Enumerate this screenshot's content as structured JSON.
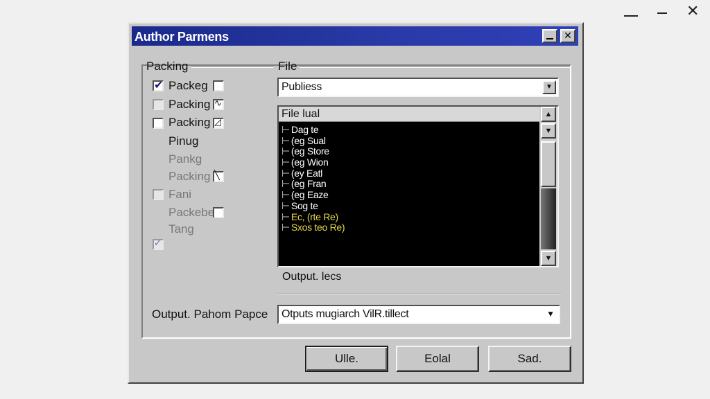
{
  "dialog": {
    "title": "Author Parmens"
  },
  "packing": {
    "group_label": "Packing",
    "rows": [
      {
        "label": "Packeg"
      },
      {
        "label": "Packing"
      },
      {
        "label": "Packing"
      },
      {
        "label": "Pinug"
      },
      {
        "label": "Pankg"
      },
      {
        "label": "Packing"
      },
      {
        "label": "Fani"
      },
      {
        "label": "Packebe"
      },
      {
        "label": "Tang"
      }
    ]
  },
  "file": {
    "group_label": "File",
    "combo_value": "Publiess",
    "list_header": "File lual",
    "items": [
      "Dag te",
      "(eg Sual",
      "(eg Store",
      "(eg Wion",
      "(ey Eatl",
      "(eg Fran",
      "(eg Eaze",
      "Sog te",
      "Ec, (rte Re)",
      "Sxos teo Re)"
    ],
    "output_label": "Output. lecs"
  },
  "output": {
    "label": "Output. Pahom Papce",
    "value": "Otputs mugiarch VilR.tillect"
  },
  "buttons": {
    "ok": "Ulle.",
    "edit": "Eolal",
    "sad": "Sad."
  }
}
